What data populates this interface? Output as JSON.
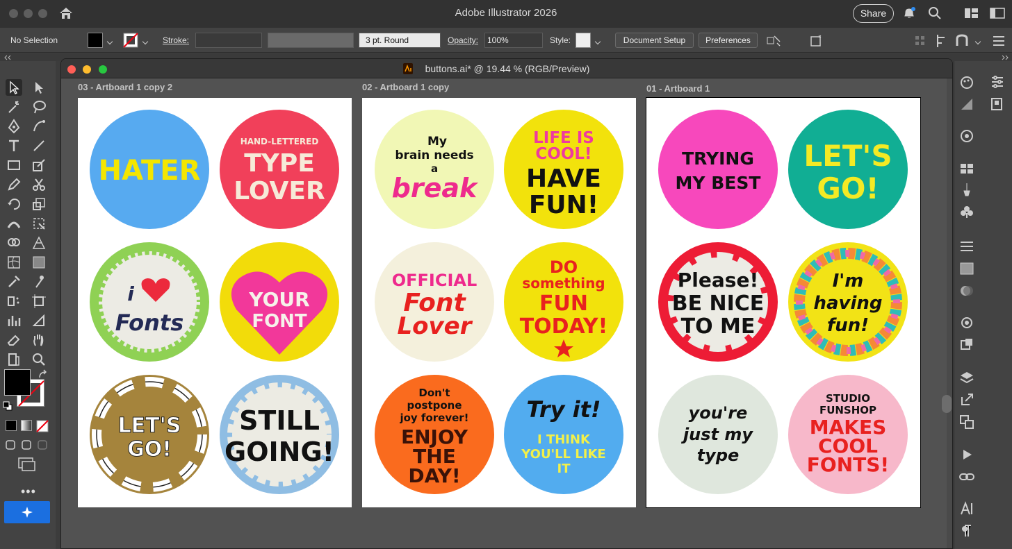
{
  "app": {
    "title": "Adobe Illustrator 2026",
    "share_label": "Share"
  },
  "control_bar": {
    "selection": "No Selection",
    "stroke_label": "Stroke:",
    "brush": "3 pt. Round",
    "opacity_label": "Opacity:",
    "opacity_value": "100%",
    "style_label": "Style:",
    "document_setup": "Document Setup",
    "preferences": "Preferences"
  },
  "document": {
    "title": "buttons.ai* @ 19.44 % (RGB/Preview)"
  },
  "artboards": [
    {
      "label": "03 - Artboard 1 copy 2",
      "buttons": [
        {
          "name": "hater",
          "bg": "#57aaf0",
          "lines": [
            "HATER"
          ]
        },
        {
          "name": "type-lover",
          "bg": "#f1405a",
          "lines": [
            "HAND-LETTERED",
            "TYPE",
            "LOVER"
          ]
        },
        {
          "name": "i-love-fonts",
          "bg": "#8fd154",
          "lines": [
            "i",
            "Fonts"
          ]
        },
        {
          "name": "your-font",
          "bg": "#f2dc0a",
          "lines": [
            "YOUR",
            "FONT"
          ]
        },
        {
          "name": "lets-go-hands",
          "bg": "#a5843c",
          "lines": [
            "LET'S",
            "GO!"
          ]
        },
        {
          "name": "still-going",
          "bg": "#8fbde3",
          "lines": [
            "STILL",
            "GOING!"
          ]
        }
      ]
    },
    {
      "label": "02 - Artboard 1 copy",
      "buttons": [
        {
          "name": "brain-break",
          "bg": "#f1f7b5",
          "lines": [
            "My",
            "brain needs",
            "a",
            "break"
          ]
        },
        {
          "name": "life-is-cool",
          "bg": "#f2e20c",
          "lines": [
            "LIFE IS",
            "COOL!",
            "HAVE",
            "FUN!"
          ]
        },
        {
          "name": "official-font-lover",
          "bg": "#f4f0dc",
          "lines": [
            "OFFICIAL",
            "Font",
            "Lover"
          ]
        },
        {
          "name": "do-something-fun",
          "bg": "#f2e20c",
          "lines": [
            "DO",
            "something",
            "FUN",
            "TODAY!"
          ]
        },
        {
          "name": "enjoy-the-day",
          "bg": "#fa6b1e",
          "lines": [
            "Don't",
            "postpone",
            "joy forever!",
            "ENJOY",
            "THE",
            "DAY!"
          ]
        },
        {
          "name": "try-it",
          "bg": "#52acef",
          "lines": [
            "Try it!",
            "I THINK",
            "YOU'LL LIKE",
            "IT"
          ]
        }
      ]
    },
    {
      "label": "01 - Artboard 1",
      "buttons": [
        {
          "name": "trying-my-best",
          "bg": "#f748bc",
          "lines": [
            "TRYING",
            "MY BEST"
          ]
        },
        {
          "name": "lets-go",
          "bg": "#11ae94",
          "lines": [
            "LET'S",
            "GO!"
          ]
        },
        {
          "name": "be-nice",
          "bg": "#ed1c35",
          "lines": [
            "Please!",
            "BE NICE",
            "TO ME"
          ]
        },
        {
          "name": "having-fun",
          "bg": "#f2e316",
          "lines": [
            "I'm",
            "having",
            "fun!"
          ]
        },
        {
          "name": "just-my-type",
          "bg": "#dfe7dd",
          "lines": [
            "you're",
            "just my",
            "type"
          ]
        },
        {
          "name": "makes-cool-fonts",
          "bg": "#f7b8ca",
          "lines": [
            "STUDIO",
            "FUNSHOP",
            "MAKES",
            "COOL",
            "FONTS!"
          ]
        }
      ]
    }
  ]
}
